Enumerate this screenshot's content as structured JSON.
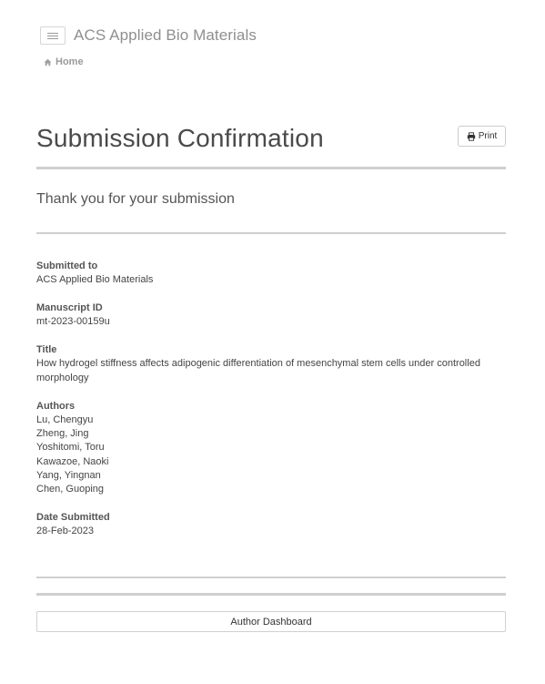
{
  "header": {
    "menu_icon": "hamburger-menu-icon",
    "app_title": "ACS Applied Bio Materials"
  },
  "breadcrumb": {
    "home_icon": "home-icon",
    "home_label": "Home"
  },
  "page": {
    "title": "Submission Confirmation",
    "print_icon": "print-icon",
    "print_label": "Print",
    "thanks": "Thank you for your submission"
  },
  "submission": {
    "submitted_to_label": "Submitted to",
    "submitted_to": "ACS Applied Bio Materials",
    "manuscript_id_label": "Manuscript ID",
    "manuscript_id": "mt-2023-00159u",
    "title_label": "Title",
    "title": "How hydrogel stiffness affects adipogenic differentiation of mesenchymal stem cells under controlled morphology",
    "authors_label": "Authors",
    "authors": [
      "Lu, Chengyu",
      "Zheng, Jing",
      "Yoshitomi, Toru",
      "Kawazoe, Naoki",
      "Yang, Yingnan",
      "Chen, Guoping"
    ],
    "date_submitted_label": "Date Submitted",
    "date_submitted": "28-Feb-2023"
  },
  "footer": {
    "dashboard_label": "Author Dashboard"
  },
  "colors": {
    "rule": "#cfcfcf",
    "title_text": "#4a4a4a",
    "muted_text": "#8f8f8f"
  }
}
